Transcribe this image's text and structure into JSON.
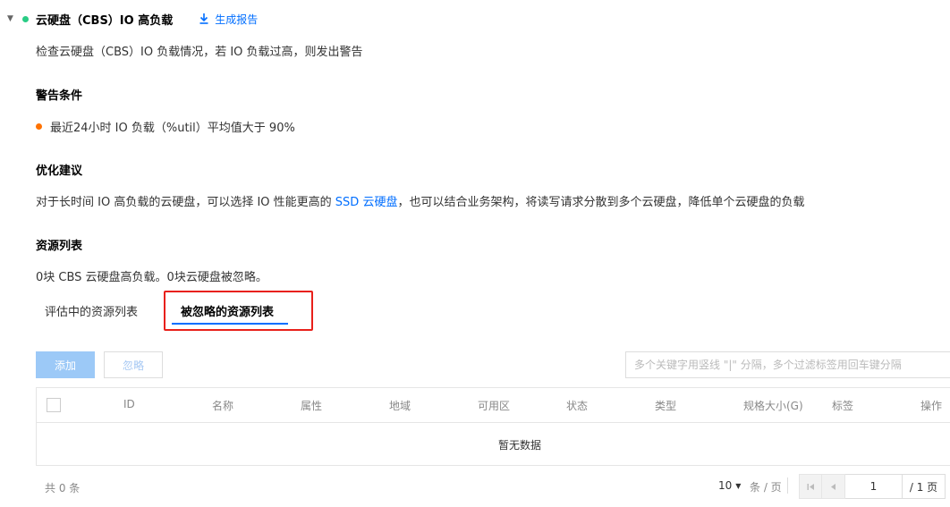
{
  "header": {
    "title": "云硬盘（CBS）IO 高负载",
    "report_label": "生成报告",
    "status_color": "#29cc85"
  },
  "description": "检查云硬盘（CBS）IO 负载情况，若 IO 负载过高，则发出警告",
  "warning": {
    "title": "警告条件",
    "condition": "最近24小时 IO 负载（%util）平均值大于 90%",
    "dot_color": "#ff7200"
  },
  "advice": {
    "title": "优化建议",
    "text_before": "对于长时间 IO 高负载的云硬盘，可以选择 IO 性能更高的 ",
    "link": "SSD 云硬盘",
    "text_after": "，也可以结合业务架构，将读写请求分散到多个云硬盘，降低单个云硬盘的负载"
  },
  "resources": {
    "title": "资源列表",
    "summary": "0块 CBS 云硬盘高负载。0块云硬盘被忽略。",
    "tabs": [
      {
        "label": "评估中的资源列表",
        "active": false
      },
      {
        "label": "被忽略的资源列表",
        "active": true
      }
    ]
  },
  "toolbar": {
    "add_label": "添加",
    "ignore_label": "忽略",
    "search_placeholder": "多个关键字用竖线 \"|\" 分隔，多个过滤标签用回车键分隔"
  },
  "table": {
    "columns": [
      "ID",
      "名称",
      "属性",
      "地域",
      "可用区",
      "状态",
      "类型",
      "规格大小(G)",
      "标签",
      "操作"
    ],
    "empty_text": "暂无数据"
  },
  "pagination": {
    "total": "共 0 条",
    "page_size": "10",
    "per_page_label": "条 / 页",
    "current_page": "1",
    "total_pages": "/ 1 页"
  },
  "colors": {
    "accent": "#006eff",
    "highlight": "#e8201a"
  }
}
